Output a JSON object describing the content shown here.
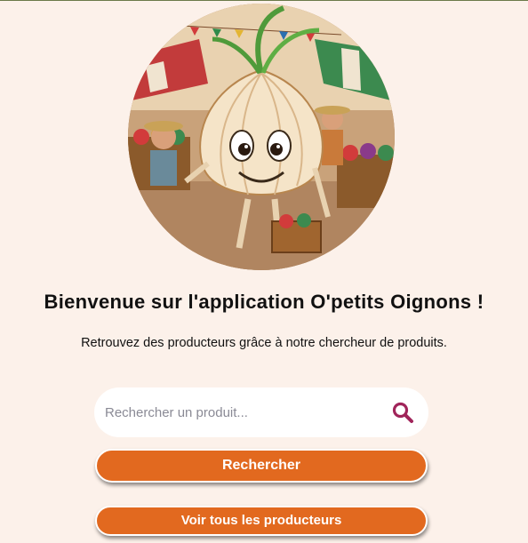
{
  "hero": {
    "image_alt": "Onion mascot in a market"
  },
  "header": {
    "title": "Bienvenue sur l'application O'petits Oignons !",
    "subtitle": "Retrouvez des producteurs grâce à notre chercheur de produits."
  },
  "search": {
    "placeholder": "Rechercher un produit...",
    "value": "",
    "icon": "search-icon"
  },
  "actions": {
    "search_label": "Rechercher",
    "all_producers_label": "Voir tous les producteurs"
  },
  "colors": {
    "background": "#fcf1ea",
    "button": "#e2691f",
    "search_icon": "#a0245a"
  }
}
